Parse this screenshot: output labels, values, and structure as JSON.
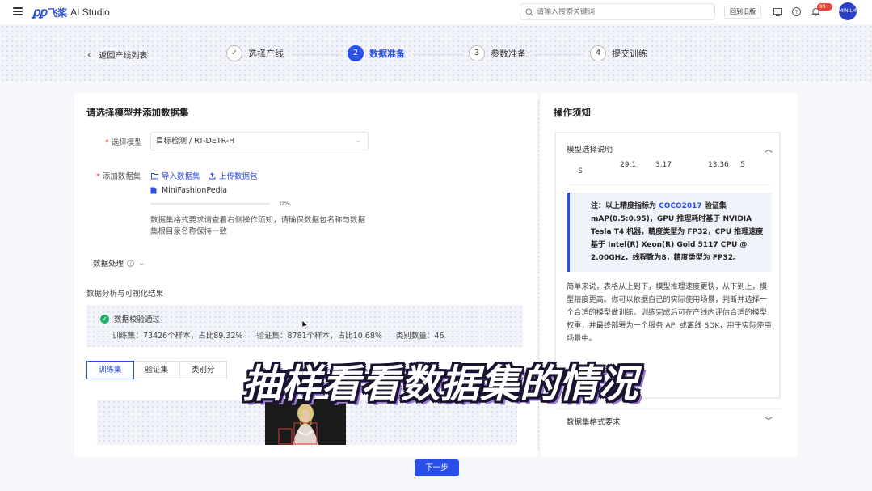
{
  "app": {
    "logo_mark": "ꝑꝑ",
    "logo_cn": "飞桨",
    "logo_en": "AI Studio",
    "search_placeholder": "请输入搜索关键词",
    "old_version": "回到旧版",
    "notification_count": "99+",
    "avatar_text": "MINILM"
  },
  "steps": {
    "back_label": "返回产线列表",
    "items": [
      {
        "num": "✓",
        "label": "选择产线",
        "state": "done"
      },
      {
        "num": "2",
        "label": "数据准备",
        "state": "active"
      },
      {
        "num": "3",
        "label": "参数准备",
        "state": "todo"
      },
      {
        "num": "4",
        "label": "提交训练",
        "state": "todo"
      }
    ]
  },
  "left": {
    "title": "请选择模型并添加数据集",
    "model_label": "选择模型",
    "model_value": "目标检测 / RT-DETR-H",
    "dataset_label": "添加数据集",
    "import_link": "导入数据集",
    "upload_link": "上传数据包",
    "file_name": "MiniFashionPedia",
    "progress_pct": "0%",
    "progress_value": 0,
    "hint": "数据集格式要求请查看右侧操作须知，请确保数据包名称与数据集根目录名称保持一致",
    "data_proc_label": "数据处理",
    "analysis_label": "数据分析与可视化结果",
    "check_ok": "数据校验通过",
    "stats": [
      "训练集：73426个样本，占比89.32%",
      "验证集：8781个样本，占比10.68%",
      "类别数量：46"
    ],
    "tabs": [
      "训练集",
      "验证集",
      "类别分"
    ]
  },
  "right": {
    "title": "操作须知",
    "acc1_title": "模型选择说明",
    "table_row": [
      "-S",
      "29.1",
      "3.17",
      "13.36",
      "5"
    ],
    "note_prefix": "注：以上精度指标为 ",
    "note_coco": "COCO2017",
    "note_rest": " 验证集 mAP(0.5:0.95)，GPU 推理耗时基于 NVIDIA Tesla T4 机器，精度类型为 FP32，CPU 推理速度基于 Intel(R) Xeon(R) Gold 5117 CPU @ 2.00GHz，线程数为8，精度类型为 FP32。",
    "desc": "简单来说，表格从上到下，模型推理速度更快，从下到上，模型精度更高。你可以依据自己的实际使用场景，判断并选择一个合适的模型做训练。训练完成后可在产线内评估合适的模型权重，并最终部署为一个服务 API 或离线 SDK，用于实际使用场景中。",
    "acc2_title": "数据集格式要求"
  },
  "footer": {
    "next_label": "下一步"
  },
  "overlay": {
    "caption": "抽样看看数据集的情况"
  },
  "colors": {
    "primary": "#2a4ee8",
    "success": "#21b26a",
    "caption_stroke": "#1b1430",
    "caption_shadow": "#9a7ad6"
  }
}
